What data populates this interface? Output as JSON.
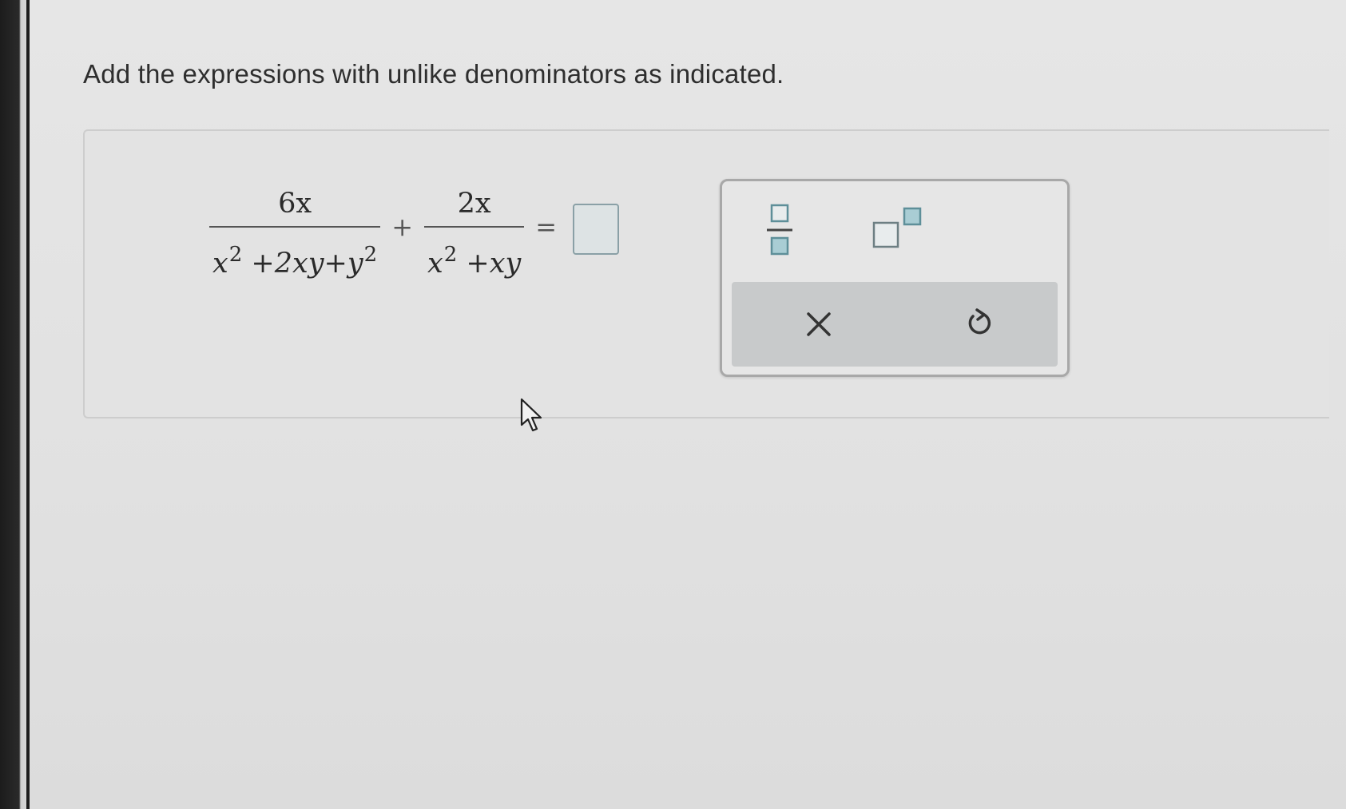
{
  "instruction": "Add the expressions with unlike denominators as indicated.",
  "expression": {
    "term1": {
      "numerator": "6x",
      "denominator": [
        {
          "base": "x",
          "exp": "2"
        },
        {
          "base": " +2xy+y",
          "exp": "2"
        }
      ]
    },
    "plus": "+",
    "term2": {
      "numerator": "2x",
      "denominator": [
        {
          "base": "x",
          "exp": "2"
        },
        {
          "base": " +xy",
          "exp": ""
        }
      ]
    },
    "equals": "="
  },
  "answer": {
    "value": ""
  },
  "palette": {
    "tools": [
      {
        "name": "fraction-template-icon"
      },
      {
        "name": "exponent-template-icon"
      }
    ],
    "clear_icon": "close-icon",
    "undo_icon": "undo-icon"
  },
  "colors": {
    "accent": "#5e8f99",
    "accent_light": "#a9cdd4",
    "palette_bar": "#c8cacb"
  }
}
